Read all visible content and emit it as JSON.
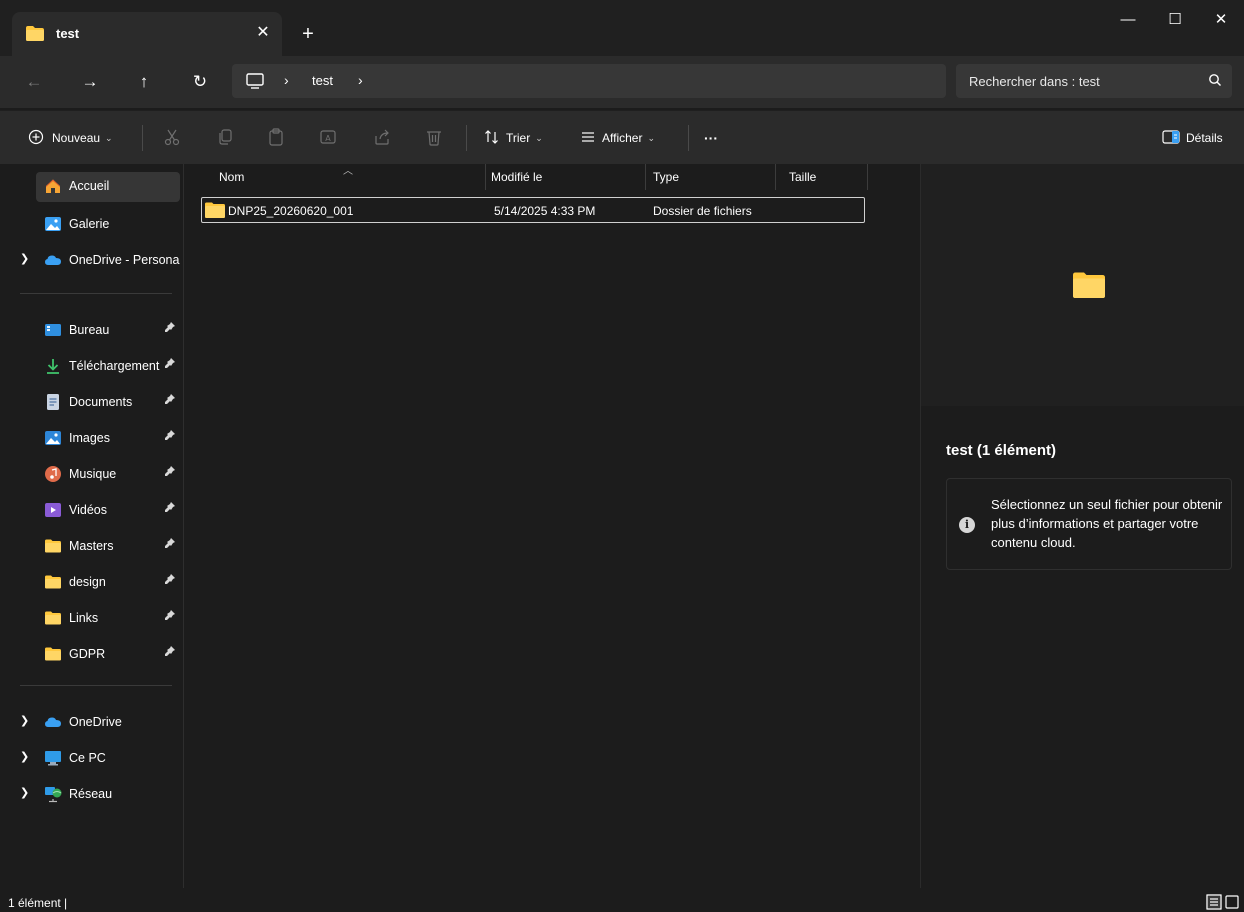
{
  "window": {
    "tab_title": "test",
    "tab_close": "✕",
    "new_tab": "+",
    "minimize": "—",
    "maximize": "☐",
    "close": "✕"
  },
  "nav": {
    "back": "←",
    "forward": "→",
    "up": "↑",
    "refresh": "↻",
    "breadcrumb": [
      "test"
    ],
    "separator": "›",
    "search_placeholder": "Rechercher dans : test"
  },
  "toolbar": {
    "new_label": "Nouveau",
    "sort_label": "Trier",
    "view_label": "Afficher",
    "more_label": "···",
    "details_label": "Détails"
  },
  "sidebar": {
    "top": [
      {
        "label": "Accueil",
        "icon": "home-icon",
        "selected": true
      },
      {
        "label": "Galerie",
        "icon": "gallery-icon"
      },
      {
        "label": "OneDrive - Persona",
        "icon": "cloud-icon",
        "expandable": true
      }
    ],
    "pinned": [
      {
        "label": "Bureau",
        "icon": "desktop-icon"
      },
      {
        "label": "Téléchargement",
        "icon": "download-icon"
      },
      {
        "label": "Documents",
        "icon": "documents-icon"
      },
      {
        "label": "Images",
        "icon": "images-icon"
      },
      {
        "label": "Musique",
        "icon": "music-icon"
      },
      {
        "label": "Vidéos",
        "icon": "videos-icon"
      },
      {
        "label": "Masters",
        "icon": "folder-icon"
      },
      {
        "label": "design",
        "icon": "folder-icon"
      },
      {
        "label": "Links",
        "icon": "folder-icon"
      },
      {
        "label": "GDPR",
        "icon": "folder-icon"
      }
    ],
    "bottom": [
      {
        "label": "OneDrive",
        "icon": "cloud-icon"
      },
      {
        "label": "Ce PC",
        "icon": "pc-icon"
      },
      {
        "label": "Réseau",
        "icon": "network-icon"
      }
    ]
  },
  "file_list": {
    "columns": [
      "Nom",
      "Modifié le",
      "Type",
      "Taille"
    ],
    "rows": [
      {
        "name": "DNP25_20260620_001",
        "modified": "5/14/2025 4:33 PM",
        "type": "Dossier de fichiers",
        "size": ""
      }
    ]
  },
  "details": {
    "title": "test (1 élément)",
    "info": "Sélectionnez un seul fichier pour obtenir plus d’informations et partager votre contenu cloud.",
    "info_glyph": "i"
  },
  "status": {
    "count": "1 élément  |"
  },
  "colors": {
    "background": "#1c1c1c",
    "toolbar": "#2b2b2b",
    "folder_yellow": "#ffc83d",
    "accent_blue": "#3aa0f3"
  }
}
